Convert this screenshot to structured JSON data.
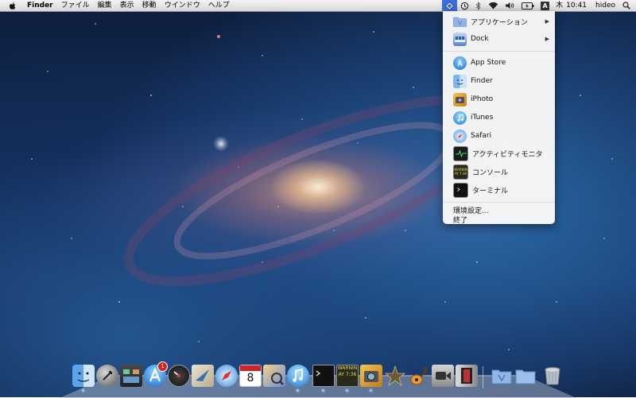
{
  "menubar": {
    "app_name": "Finder",
    "menus": [
      "ファイル",
      "編集",
      "表示",
      "移動",
      "ウインドウ",
      "ヘルプ"
    ],
    "status": {
      "input_source": "A",
      "day": "木",
      "time": "10:41",
      "user": "hideo"
    }
  },
  "dropdown": {
    "items": [
      {
        "label": "アプリケーション",
        "icon": "folder-applications-icon",
        "submenu": true
      },
      {
        "label": "Dock",
        "icon": "dock-icon",
        "submenu": true
      },
      {
        "label": "App Store",
        "icon": "app-store-icon"
      },
      {
        "label": "Finder",
        "icon": "finder-icon"
      },
      {
        "label": "iPhoto",
        "icon": "iphoto-icon"
      },
      {
        "label": "iTunes",
        "icon": "itunes-icon"
      },
      {
        "label": "Safari",
        "icon": "safari-icon"
      },
      {
        "label": "アクティビティモニタ",
        "icon": "activity-monitor-icon"
      },
      {
        "label": "コンソール",
        "icon": "console-icon"
      },
      {
        "label": "ターミナル",
        "icon": "terminal-icon"
      }
    ],
    "preferences": "環境設定...",
    "quit": "終了"
  },
  "dock": {
    "calendar_day": "8",
    "app_store_badge": "1",
    "console_text": "WARNIN AY 7:36"
  },
  "colors": {
    "menu_highlight": "#3a6ee0",
    "badge": "#d9201e"
  }
}
